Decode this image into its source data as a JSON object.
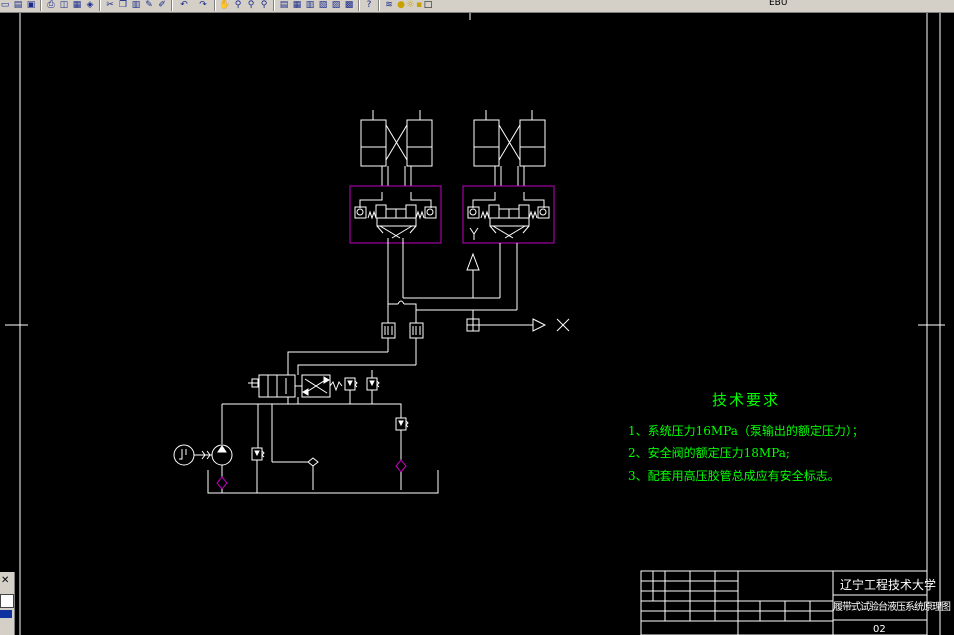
{
  "toolbar": {
    "icons": [
      "new-icon",
      "open-icon",
      "save-icon",
      "print-icon",
      "preview-icon",
      "plot-icon",
      "publish-icon",
      "cut-icon",
      "copy-icon",
      "paste-icon",
      "match-icon",
      "brush-icon",
      "undo-icon",
      "redo-icon",
      "pan-icon",
      "zoom-realtime-icon",
      "zoom-window-icon",
      "zoom-previous-icon",
      "properties-icon",
      "design-center-icon",
      "tool-palettes-icon",
      "sheet-set-icon",
      "markup-icon",
      "calculator-icon",
      "help-icon",
      "layer-manager-icon",
      "bulb-icon",
      "sun-icon",
      "lock-icon",
      "color-swatch-icon"
    ],
    "layer_name": "EBU"
  },
  "technical_requirements": {
    "title": "技术要求",
    "items": [
      "1、系统压力16MPa（泵输出的额定压力）；",
      "2、安全阀的额定压力18MPa;",
      "3、配套用高压胶管总成应有安全标志。"
    ]
  },
  "title_block": {
    "university": "辽宁工程技术大学",
    "drawing_name": "履带式试验台液压系统原理图",
    "sheet_number": "02"
  },
  "colors": {
    "background": "#000000",
    "linework": "#ffffff",
    "valve_frame": "#c000c0",
    "notes": "#00ff00",
    "toolbar": "#d4d0c8"
  }
}
